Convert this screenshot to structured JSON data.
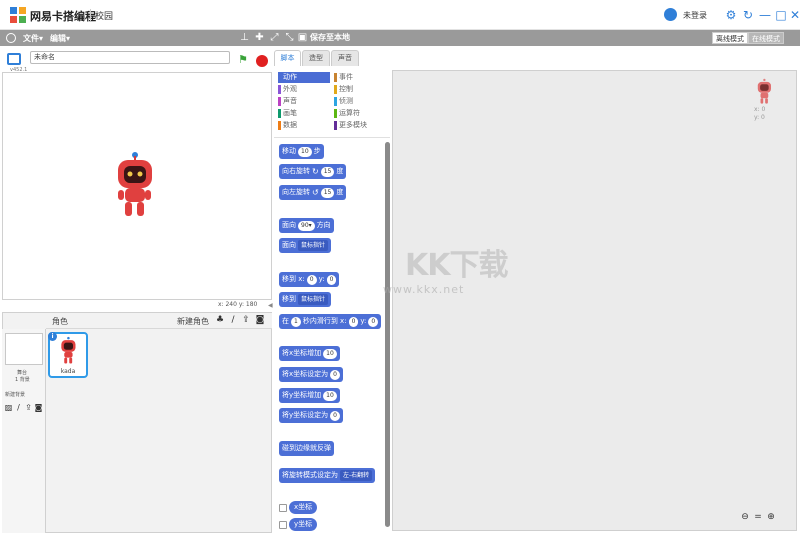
{
  "titlebar": {
    "app_title": "网易卡搭编程",
    "campus": "校园",
    "login": "未登录",
    "controls": [
      "⚙",
      "↻",
      "—",
      "□",
      "✕"
    ]
  },
  "menubar": {
    "file": "文件▾",
    "edit": "编辑▾",
    "save_local": "保存至本地",
    "mode_offline": "离线模式",
    "mode_online": "在线模式"
  },
  "stage": {
    "version": "v452.1",
    "project_name": "未命名",
    "coords": "x: 240  y: 180"
  },
  "sprites": {
    "title": "角色",
    "new_sprite": "新建角色",
    "backdrop_label": "舞台",
    "backdrop_count": "1 背景",
    "new_backdrop": "新建背景",
    "sprite_name": "kada"
  },
  "tabs": {
    "scripts": "脚本",
    "costumes": "造型",
    "sounds": "声音"
  },
  "categories": [
    {
      "label": "动作",
      "color": "#4a6cd4",
      "active": true
    },
    {
      "label": "事件",
      "color": "#c88330"
    },
    {
      "label": "外观",
      "color": "#8a55d7"
    },
    {
      "label": "控制",
      "color": "#e1a91a"
    },
    {
      "label": "声音",
      "color": "#bb42c3"
    },
    {
      "label": "侦测",
      "color": "#2ca5e2"
    },
    {
      "label": "画笔",
      "color": "#0e9a6c"
    },
    {
      "label": "运算符",
      "color": "#5cb712"
    },
    {
      "label": "数据",
      "color": "#ee7d16"
    },
    {
      "label": "更多模块",
      "color": "#632d99"
    }
  ],
  "blocks": {
    "move": {
      "a": "移动",
      "v": "10",
      "b": "步"
    },
    "turn_right": {
      "a": "向右旋转",
      "v": "15",
      "b": "度"
    },
    "turn_left": {
      "a": "向左旋转",
      "v": "15",
      "b": "度"
    },
    "point_dir": {
      "a": "面向",
      "v": "90▾",
      "b": "方向"
    },
    "point_towards": {
      "a": "面向",
      "dd": "鼠标指针"
    },
    "goto_xy": {
      "a": "移到 x:",
      "x": "0",
      "b": "y:",
      "y": "0"
    },
    "goto": {
      "a": "移到",
      "dd": "鼠标指针"
    },
    "glide": {
      "a": "在",
      "t": "1",
      "b": "秒内滑行到 x:",
      "x": "0",
      "c": "y:",
      "y": "0"
    },
    "change_x": {
      "a": "将x坐标增加",
      "v": "10"
    },
    "set_x": {
      "a": "将x坐标设定为",
      "v": "0"
    },
    "change_y": {
      "a": "将y坐标增加",
      "v": "10"
    },
    "set_y": {
      "a": "将y坐标设定为",
      "v": "0"
    },
    "bounce": {
      "a": "碰到边缘就反弹"
    },
    "rotation_style": {
      "a": "将旋转模式设定为",
      "dd": "左-右翻转"
    },
    "x_pos": "x坐标",
    "y_pos": "y坐标"
  },
  "script_area": {
    "mini_x": "x: 0",
    "mini_y": "y: 0",
    "zoom_out": "🔍−",
    "zoom_reset": "=",
    "zoom_in": "🔍+"
  },
  "watermark": {
    "text": "KK下载",
    "url": "www.kkx.net"
  },
  "colors": {
    "accent": "#2f7fd8",
    "motion_block": "#4c6fd6",
    "menubar": "#9a9a9a"
  }
}
